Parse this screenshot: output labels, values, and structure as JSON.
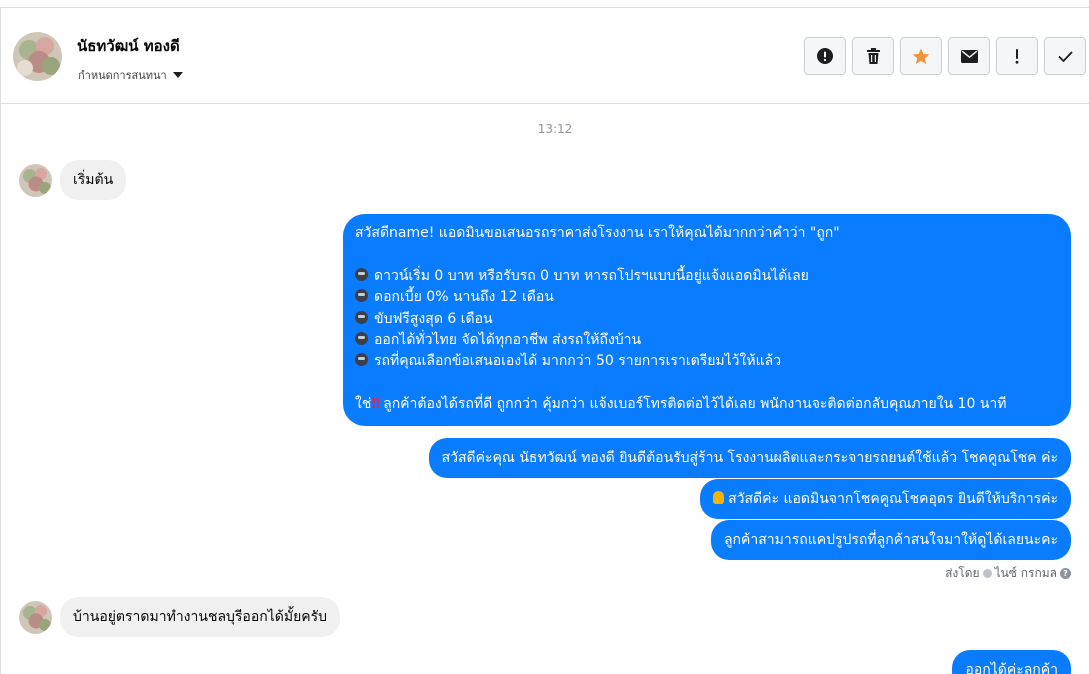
{
  "header": {
    "contact_name": "นัธทวัฒน์ ทองดี",
    "conversation_label": "กำหนดการสนทนา",
    "actions": [
      {
        "name": "report-button",
        "icon": "exclamation-circle-icon"
      },
      {
        "name": "delete-button",
        "icon": "trash-icon"
      },
      {
        "name": "star-button",
        "icon": "star-icon"
      },
      {
        "name": "mark-unread-button",
        "icon": "envelope-icon"
      },
      {
        "name": "important-button",
        "icon": "exclamation-icon"
      },
      {
        "name": "done-button",
        "icon": "check-icon"
      }
    ]
  },
  "thread": {
    "timestamp": "13:12",
    "incoming_1": "เริ่มต้น",
    "outgoing_big": {
      "line1": "สวัสดีname! แอดมินขอเสนอรถราคาส่งโรงงาน เราให้คุณได้มากกว่าคำว่า \"ถูก\"",
      "bullets": [
        "ดาวน์เริ่ม 0 บาท หรือรับรถ 0 บาท หารถโปรฯแบบนี้อยู่แจ้งแอดมินได้เลย",
        "ดอกเบี้ย 0% นานถึง 12 เดือน",
        "ขับฟรีสูงสุด 6 เดือน",
        "ออกได้ทั่วไทย จัดได้ทุกอาชีพ ส่งรถให้ถึงบ้าน",
        "รถที่คุณเลือกข้อเสนอเองได้ มากกว่า 50 รายการเราเตรียมไว้ให้แล้ว"
      ],
      "closing_prefix": "ใช่",
      "closing_mark": "‼",
      "closing": "ลูกค้าต้องได้รถที่ดี ถูกกว่า คุ้มกว่า แจ้งเบอร์โทรติดต่อไว้ได้เลย พนักงานจะติดต่อกลับคุณภายใน 10 นาที"
    },
    "outgoing_2": "สวัสดีค่ะคุณ นัธทวัฒน์ ทองดี ยินดีต้อนรับสู่ร้าน โรงงานผลิตและกระจายรถยนต์ใช้แล้ว โชคคูณโชค ค่ะ",
    "outgoing_3": "สวัสดีค่ะ แอดมินจากโชคคูณโชคอุดร ยินดีให้บริการค่ะ",
    "outgoing_4": "ลูกค้าสามารถแคปรูปรถที่ลูกค้าสนใจมาให้ดูได้เลยนะคะ",
    "sent_by_prefix": "ส่งโดย",
    "sent_by_name": "ไนซ์ กรกมล",
    "incoming_2": "บ้านอยู่ตราดมาทำงานชลบุรีออกได้มั้ยครับ",
    "outgoing_5": "ออกได้ค่ะลูกค้า"
  },
  "colors": {
    "outgoing_bubble": "#0a7cff",
    "incoming_bubble": "#f0f0f0",
    "star": "#f7923a"
  }
}
